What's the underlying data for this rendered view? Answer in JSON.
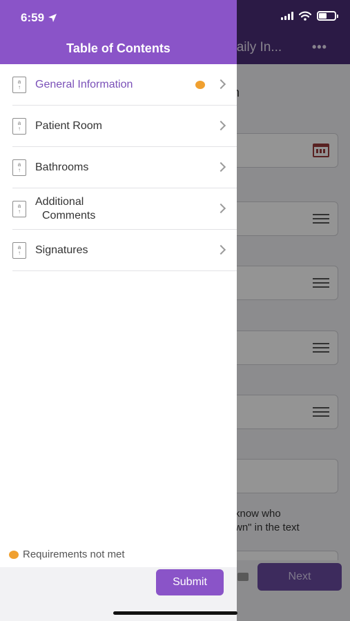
{
  "status_bar": {
    "time": "6:59"
  },
  "background_form": {
    "title": "Daily In...",
    "menu_label": "•••",
    "section_fragment": "n",
    "note_line1": "know who",
    "note_line2": "wn\" in the text",
    "next_label": "Next"
  },
  "drawer": {
    "title": "Table of Contents",
    "items": [
      {
        "label": "General Information",
        "active": true,
        "requirement_unmet": true
      },
      {
        "label": "Patient Room",
        "active": false,
        "requirement_unmet": false
      },
      {
        "label": "Bathrooms",
        "active": false,
        "requirement_unmet": false
      },
      {
        "label_line1": "Additional",
        "label_line2": "Comments",
        "active": false,
        "requirement_unmet": false
      },
      {
        "label": "Signatures",
        "active": false,
        "requirement_unmet": false
      }
    ],
    "legend_text": "Requirements not met",
    "submit_label": "Submit"
  },
  "colors": {
    "accent": "#8a54c8",
    "header_dark": "#4b2e78",
    "requirement_dot": "#f0a030",
    "active_text": "#7a50b8"
  },
  "icons": {
    "location": "location-arrow-icon",
    "signal": "cellular-signal-icon",
    "wifi": "wifi-icon",
    "battery": "battery-icon",
    "item": "document-icon",
    "chevron": "chevron-right-icon",
    "field_list": "list-lines-icon",
    "field_calendar": "calendar-icon"
  }
}
